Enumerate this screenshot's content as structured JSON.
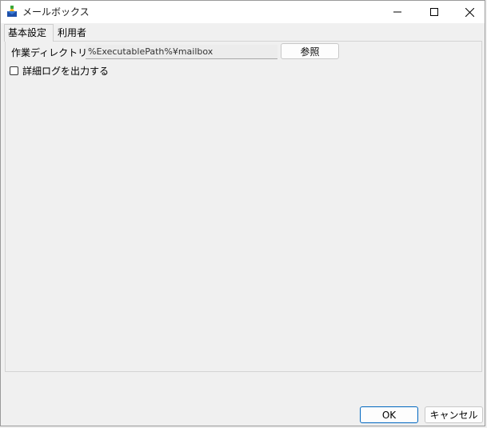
{
  "window": {
    "title": "メールボックス"
  },
  "tabs": [
    {
      "label": "基本設定",
      "active": true
    },
    {
      "label": "利用者",
      "active": false
    }
  ],
  "basic": {
    "workdir_label": "作業ディレクトリ",
    "workdir_value": "%ExecutablePath%¥mailbox",
    "browse_label": "参照",
    "detail_log_label": "詳細ログを出力する",
    "detail_log_checked": false
  },
  "footer": {
    "ok_label": "OK",
    "cancel_label": "キャンセル"
  },
  "colors": {
    "accent": "#0067c0",
    "window_bg": "#f0f0f0",
    "titlebar_bg": "#ffffff"
  }
}
